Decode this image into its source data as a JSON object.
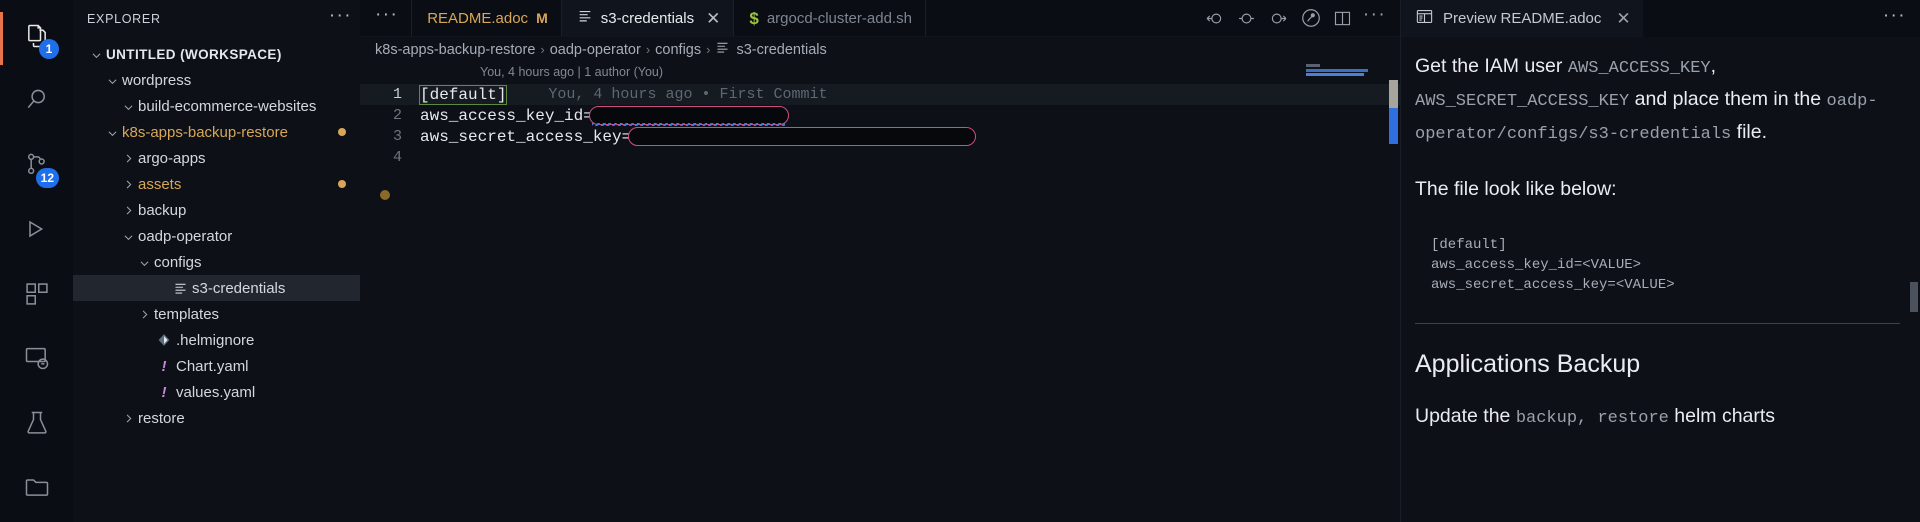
{
  "activitybar": {
    "items": [
      {
        "name": "explorer",
        "icon": "files-icon",
        "badge": "1",
        "active": true
      },
      {
        "name": "search",
        "icon": "search-icon",
        "badge": "",
        "active": false
      },
      {
        "name": "source-control",
        "icon": "source-control-icon",
        "badge": "12",
        "active": false
      },
      {
        "name": "run-and-debug",
        "icon": "run-debug-icon",
        "badge": "",
        "active": false
      },
      {
        "name": "extensions",
        "icon": "extensions-icon",
        "badge": "",
        "active": false
      },
      {
        "name": "remote-explorer",
        "icon": "remote-explorer-icon",
        "badge": "",
        "active": false
      },
      {
        "name": "testing",
        "icon": "beaker-icon",
        "badge": "",
        "active": false
      },
      {
        "name": "folder-view",
        "icon": "folder-icon",
        "badge": "",
        "active": false
      }
    ]
  },
  "sidebar": {
    "title": "EXPLORER",
    "more_actions": "···",
    "tree": [
      {
        "label": "UNTITLED (WORKSPACE)",
        "indent": 0,
        "chevron": "down",
        "icon": "",
        "kind": "root",
        "color": "default",
        "modified": false,
        "selected": false
      },
      {
        "label": "wordpress",
        "indent": 1,
        "chevron": "down",
        "icon": "",
        "kind": "folder",
        "color": "default",
        "modified": false,
        "selected": false
      },
      {
        "label": "build-ecommerce-websites",
        "indent": 2,
        "chevron": "down",
        "icon": "",
        "kind": "folder",
        "color": "default",
        "modified": false,
        "selected": false
      },
      {
        "label": "k8s-apps-backup-restore",
        "indent": 1,
        "chevron": "down",
        "icon": "",
        "kind": "folder",
        "color": "amber",
        "modified": true,
        "selected": false
      },
      {
        "label": "argo-apps",
        "indent": 2,
        "chevron": "right",
        "icon": "",
        "kind": "folder",
        "color": "default",
        "modified": false,
        "selected": false
      },
      {
        "label": "assets",
        "indent": 2,
        "chevron": "right",
        "icon": "",
        "kind": "folder",
        "color": "amber",
        "modified": true,
        "selected": false
      },
      {
        "label": "backup",
        "indent": 2,
        "chevron": "right",
        "icon": "",
        "kind": "folder",
        "color": "default",
        "modified": false,
        "selected": false
      },
      {
        "label": "oadp-operator",
        "indent": 2,
        "chevron": "down",
        "icon": "",
        "kind": "folder",
        "color": "default",
        "modified": false,
        "selected": false
      },
      {
        "label": "configs",
        "indent": 3,
        "chevron": "down",
        "icon": "",
        "kind": "folder",
        "color": "default",
        "modified": false,
        "selected": false
      },
      {
        "label": "s3-credentials",
        "indent": 4,
        "chevron": "none",
        "icon": "settings-file-icon",
        "kind": "file",
        "color": "default",
        "modified": false,
        "selected": true
      },
      {
        "label": "templates",
        "indent": 3,
        "chevron": "right",
        "icon": "",
        "kind": "folder",
        "color": "default",
        "modified": false,
        "selected": false
      },
      {
        "label": ".helmignore",
        "indent": 3,
        "chevron": "none",
        "icon": "helm-icon",
        "kind": "file",
        "color": "default",
        "modified": false,
        "selected": false
      },
      {
        "label": "Chart.yaml",
        "indent": 3,
        "chevron": "none",
        "icon": "yaml-icon",
        "kind": "file",
        "color": "default",
        "modified": false,
        "selected": false
      },
      {
        "label": "values.yaml",
        "indent": 3,
        "chevron": "none",
        "icon": "yaml-icon",
        "kind": "file",
        "color": "default",
        "modified": false,
        "selected": false
      },
      {
        "label": "restore",
        "indent": 2,
        "chevron": "right",
        "icon": "",
        "kind": "folder",
        "color": "default",
        "modified": false,
        "selected": false
      }
    ]
  },
  "editor": {
    "leading_more": "···",
    "tabs": [
      {
        "label": "README.adoc",
        "icon": "",
        "modified_flag": "M",
        "active": false,
        "closable": false,
        "color": "amber"
      },
      {
        "label": "s3-credentials",
        "icon": "settings-file-icon",
        "modified_flag": "",
        "active": true,
        "closable": true,
        "color": "default"
      },
      {
        "label": "argocd-cluster-add.sh",
        "icon": "shell-icon",
        "modified_flag": "",
        "active": false,
        "closable": false,
        "color": "default"
      }
    ],
    "actions": [
      {
        "name": "go-back-icon"
      },
      {
        "name": "current-change-icon"
      },
      {
        "name": "go-forward-icon"
      },
      {
        "name": "source-control-inline-icon"
      },
      {
        "name": "split-editor-icon"
      },
      {
        "name": "more-actions-icon"
      }
    ],
    "breadcrumbs": [
      "k8s-apps-backup-restore",
      "oadp-operator",
      "configs",
      "s3-credentials"
    ],
    "breadcrumb_separator": "›",
    "breadcrumb_file_icon": "settings-file-icon",
    "blame_header": "You, 4 hours ago | 1 author (You)",
    "inline_blame": "You, 4 hours ago • First Commit",
    "lines": [
      {
        "number": "1",
        "text": "[default]",
        "current": true,
        "redacted": false
      },
      {
        "number": "2",
        "text": "aws_access_key_id=",
        "current": false,
        "redacted": true
      },
      {
        "number": "3",
        "text": "aws_secret_access_key=",
        "current": false,
        "redacted": true
      },
      {
        "number": "4",
        "text": "",
        "current": false,
        "redacted": false
      }
    ]
  },
  "preview": {
    "tab_label": "Preview README.adoc",
    "tab_icon": "preview-icon",
    "close_icon": "close-icon",
    "more_actions": "···",
    "paragraph1": {
      "part1": "Get the IAM user ",
      "code1": "AWS_ACCESS_KEY",
      "part2": ", ",
      "code2": "AWS_SECRET_ACCESS_KEY",
      "part3": " and place them in the ",
      "code3": "oadp-operator/configs/s3-credentials",
      "part4": " file."
    },
    "paragraph2": "The file look like below:",
    "code_block": "[default]\naws_access_key_id=<VALUE>\naws_secret_access_key=<VALUE>",
    "heading2": "Applications Backup",
    "paragraph3": {
      "part1": "Update the ",
      "code1": "backup, restore",
      "part2": " helm charts"
    }
  },
  "colors": {
    "accent_orange": "#e8734a",
    "badge_blue": "#1f6feb",
    "folder_amber": "#d8a657",
    "redaction_pink": "#cf4d84",
    "editor_bg": "#0d1017",
    "chrome_bg": "#0a0d14"
  }
}
